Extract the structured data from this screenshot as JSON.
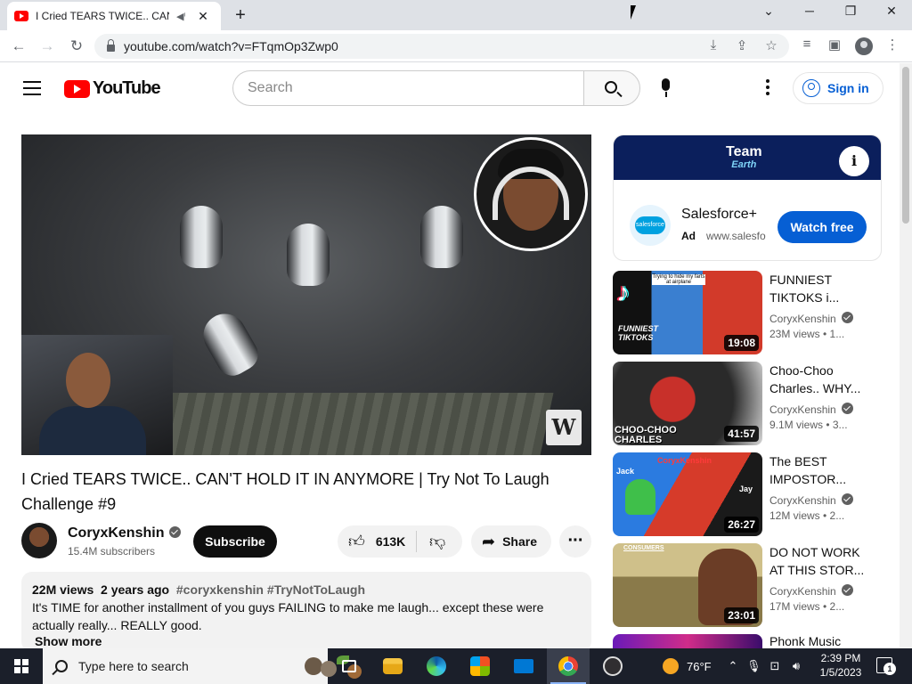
{
  "browser": {
    "tab_title": "I Cried TEARS TWICE.. CAN'T",
    "url": "youtube.com/watch?v=FTqmOp3Zwp0"
  },
  "icons": {
    "tab_favicon": "youtube-favicon-icon",
    "tab_audio": "speaker-icon",
    "tab_close": "close-icon",
    "new_tab": "plus-icon",
    "back": "back-arrow-icon",
    "forward": "forward-arrow-icon",
    "reload": "reload-icon",
    "lock": "lock-icon",
    "install": "install-app-icon",
    "share_page": "share-page-icon",
    "bookmark": "star-icon",
    "media": "media-control-icon",
    "side_panel": "side-panel-icon",
    "profile": "profile-icon",
    "browser_menu": "kebab-menu-icon"
  },
  "youtube": {
    "logo_text": "YouTube",
    "search_placeholder": "Search",
    "signin_label": "Sign in",
    "accent_color": "#065fd4",
    "brand_color": "#ff0000"
  },
  "video": {
    "title": "I Cried TEARS TWICE.. CAN'T HOLD IT IN ANYMORE | Try Not To Laugh Challenge #9",
    "watermark": "W",
    "channel": {
      "name": "CoryxKenshin",
      "subscribers": "15.4M subscribers",
      "verified": true
    },
    "subscribe_label": "Subscribe",
    "likes": "613K",
    "share_label": "Share",
    "description": {
      "views": "22M views",
      "age": "2 years ago",
      "hashtags": "#coryxkenshin #TryNotToLaugh",
      "text": "It's TIME for another installment of you guys FAILING to make me laugh... except these were actually really... REALLY good.",
      "show_more": "Show more"
    }
  },
  "ad": {
    "banner_title": "Team",
    "banner_subtitle": "Earth",
    "logo_text": "salesforce",
    "advertiser": "Salesforce+",
    "badge": "Ad",
    "domain": "www.salesfo",
    "cta": "Watch free"
  },
  "recommendations": [
    {
      "title_line1": "FUNNIEST",
      "title_line2": "TIKTOKS i...",
      "channel": "CoryxKenshin",
      "stats": "23M views • 1...",
      "duration": "19:08",
      "thumb_text": "FUNNIEST TIKTOKS",
      "thumb_caption": "Trying to hide my farts at airplane"
    },
    {
      "title_line1": "Choo-Choo",
      "title_line2": "Charles.. WHY...",
      "channel": "CoryxKenshin",
      "stats": "9.1M views • 3...",
      "duration": "41:57",
      "thumb_text": "CHOO-CHOO CHARLES"
    },
    {
      "title_line1": "The BEST",
      "title_line2": "IMPOSTOR...",
      "channel": "CoryxKenshin",
      "stats": "12M views • 2...",
      "duration": "26:27",
      "thumb_text": "CoryxKenshin",
      "thumb_label_left": "Jack",
      "thumb_label_right": "Jay"
    },
    {
      "title_line1": "DO NOT WORK",
      "title_line2": "AT THIS STOR...",
      "channel": "CoryxKenshin",
      "stats": "17M views • 2...",
      "duration": "23:01",
      "thumb_text": "CONSUMERS"
    },
    {
      "title_line1": "Phonk Music",
      "title_line2": "",
      "channel": "",
      "stats": "",
      "duration": ""
    }
  ],
  "taskbar": {
    "search_placeholder": "Type here to search",
    "temperature": "76°F",
    "time": "2:39 PM",
    "date": "1/5/2023",
    "notification_count": "1",
    "apps": [
      "task-view-icon",
      "file-explorer-icon",
      "edge-icon",
      "store-icon",
      "mail-icon",
      "chrome-icon",
      "obs-icon"
    ]
  }
}
